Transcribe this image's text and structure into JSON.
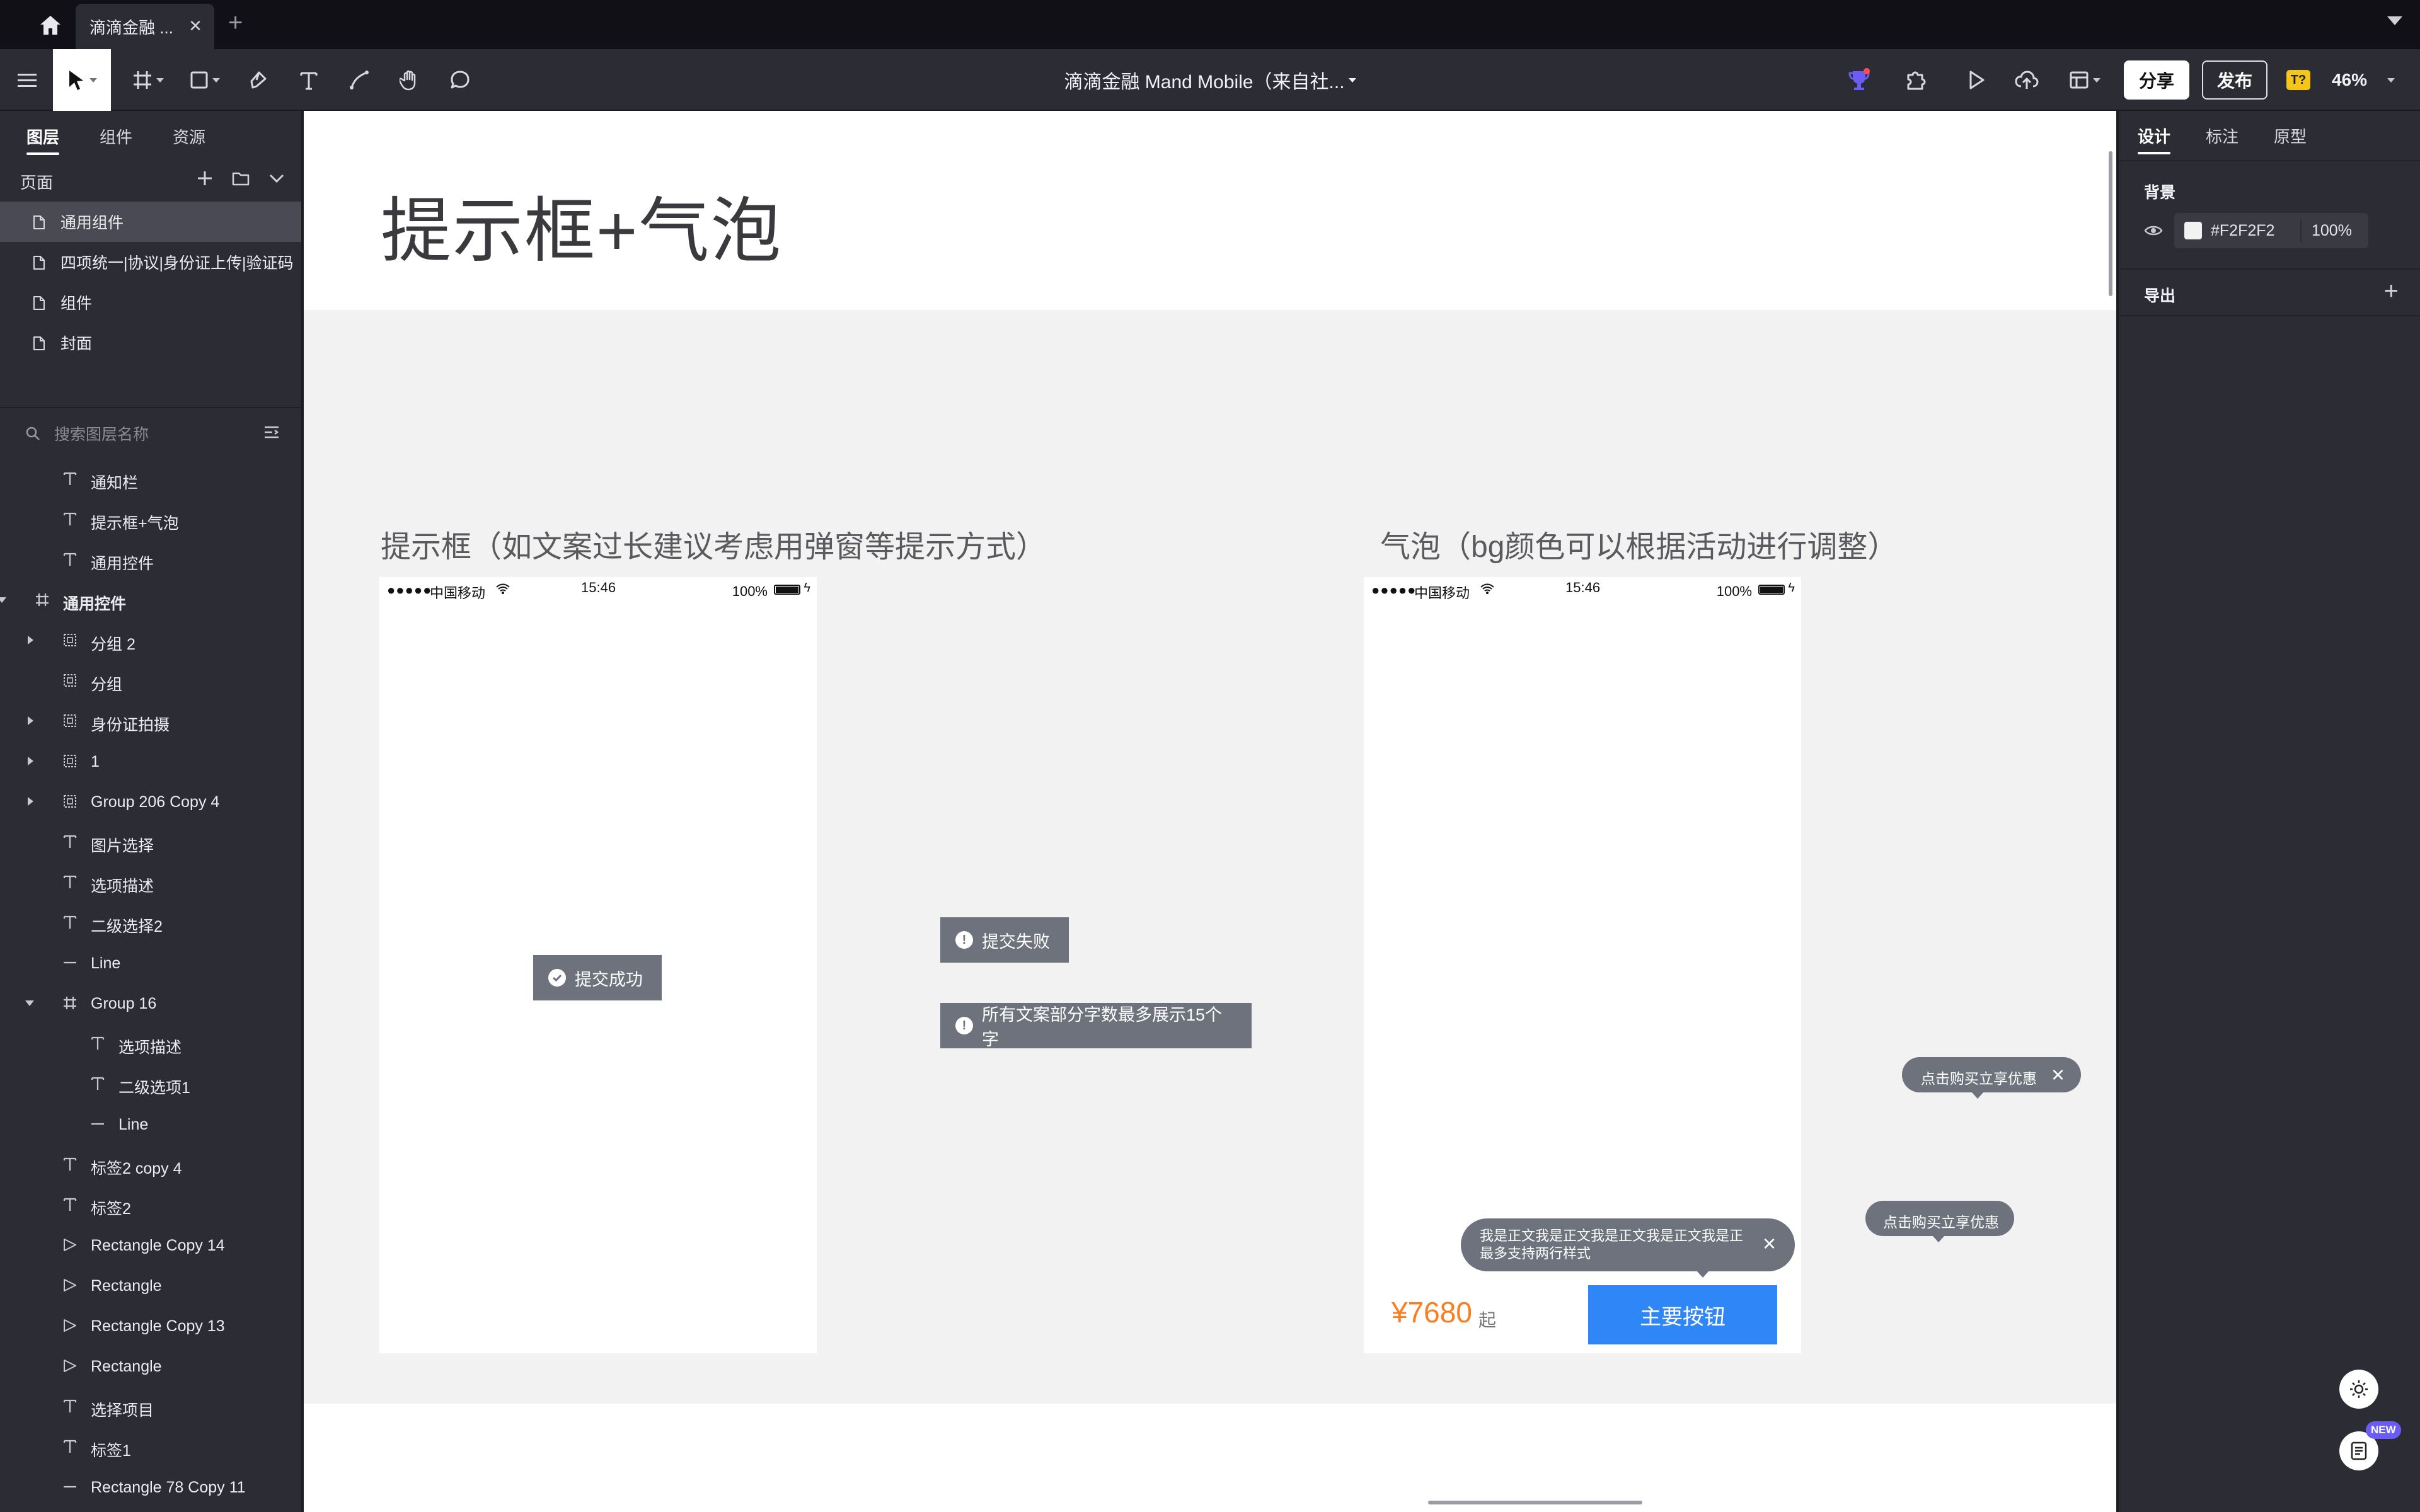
{
  "tabbar": {
    "doc_tab_label": "滴滴金融 ...",
    "close_glyph": "×",
    "new_tab_glyph": "+"
  },
  "toolbar": {
    "title": "滴滴金融 Mand Mobile（来自社...",
    "share_label": "分享",
    "publish_label": "发布",
    "badge": "T?",
    "zoom": "46%",
    "icons": [
      "menu-icon",
      "select-icon",
      "frame-icon",
      "rectangle-icon",
      "pen-icon",
      "text-icon",
      "vector-icon",
      "hand-icon",
      "comment-icon",
      "trophy-icon",
      "plugin-icon",
      "play-icon",
      "upload-icon",
      "layout-icon"
    ]
  },
  "left_panel": {
    "tabs": [
      "图层",
      "组件",
      "资源"
    ],
    "pages_header": "页面",
    "pages": [
      "通用组件",
      "四项统一|协议|身份证上传|验证码",
      "组件",
      "封面"
    ],
    "search_placeholder": "搜索图层名称",
    "layers": [
      {
        "name": "通知栏",
        "type": "text",
        "level": 1
      },
      {
        "name": "提示框+气泡",
        "type": "text",
        "level": 1
      },
      {
        "name": "通用控件",
        "type": "text",
        "level": 1
      },
      {
        "name": "通用控件",
        "type": "frame",
        "level": 0,
        "expanded": true,
        "bold": true
      },
      {
        "name": "分组 2",
        "type": "group",
        "level": 1,
        "collapsed": true
      },
      {
        "name": "分组",
        "type": "group",
        "level": 1
      },
      {
        "name": "身份证拍摄",
        "type": "group",
        "level": 1,
        "collapsed": true
      },
      {
        "name": "1",
        "type": "group",
        "level": 1,
        "collapsed": true
      },
      {
        "name": "Group 206 Copy 4",
        "type": "group",
        "level": 1,
        "collapsed": true
      },
      {
        "name": "图片选择",
        "type": "text",
        "level": 1
      },
      {
        "name": "选项描述",
        "type": "text",
        "level": 1
      },
      {
        "name": "二级选择2",
        "type": "text",
        "level": 1
      },
      {
        "name": "Line",
        "type": "line",
        "level": 1
      },
      {
        "name": "Group 16",
        "type": "frame",
        "level": 1,
        "expanded": true
      },
      {
        "name": "选项描述",
        "type": "text",
        "level": 2
      },
      {
        "name": "二级选项1",
        "type": "text",
        "level": 2
      },
      {
        "name": "Line",
        "type": "line",
        "level": 2
      },
      {
        "name": "标签2 copy 4",
        "type": "text",
        "level": 1
      },
      {
        "name": "标签2",
        "type": "text",
        "level": 1
      },
      {
        "name": "Rectangle Copy 14",
        "type": "vector",
        "level": 1
      },
      {
        "name": "Rectangle",
        "type": "vector",
        "level": 1
      },
      {
        "name": "Rectangle Copy 13",
        "type": "vector",
        "level": 1
      },
      {
        "name": "Rectangle",
        "type": "vector",
        "level": 1
      },
      {
        "name": "选择项目",
        "type": "text",
        "level": 1
      },
      {
        "name": "标签1",
        "type": "text",
        "level": 1
      },
      {
        "name": "Rectangle 78 Copy 11",
        "type": "line",
        "level": 1
      }
    ]
  },
  "canvas": {
    "section_title": "提示框+气泡",
    "left_subtitle": "提示框（如文案过长建议考虑用弹窗等提示方式）",
    "right_subtitle": "气泡（bg颜色可以根据活动进行调整）",
    "status_bar": {
      "dots": "●●●●●",
      "carrier": "中国移动",
      "time": "15:46",
      "battery": "100%",
      "bolt": "ϟ"
    },
    "toasts": {
      "success": "提交成功",
      "fail": "提交失败",
      "long": "所有文案部分字数最多展示15个字",
      "fail_icon": "!"
    },
    "bubbles": {
      "short_1": "点击购买立享优惠",
      "short_2": "点击购买立享优惠",
      "long_line1": "我是正文我是正文我是正文我是正文我是正",
      "long_line2": "最多支持两行样式",
      "close_glyph": "×"
    },
    "price": "¥7680",
    "price_suffix": "起",
    "primary_button": "主要按钮",
    "colors": {
      "toast_bg": "#6e727c",
      "primary": "#2f86f6",
      "price": "#fa7d1f",
      "artboard_bg": "#f2f2f2"
    }
  },
  "right_panel": {
    "tabs": [
      "设计",
      "标注",
      "原型"
    ],
    "background_label": "背景",
    "background_hex": "#F2F2F2",
    "background_opacity": "100%",
    "export_label": "导出",
    "export_add": "+",
    "new_badge": "NEW"
  }
}
